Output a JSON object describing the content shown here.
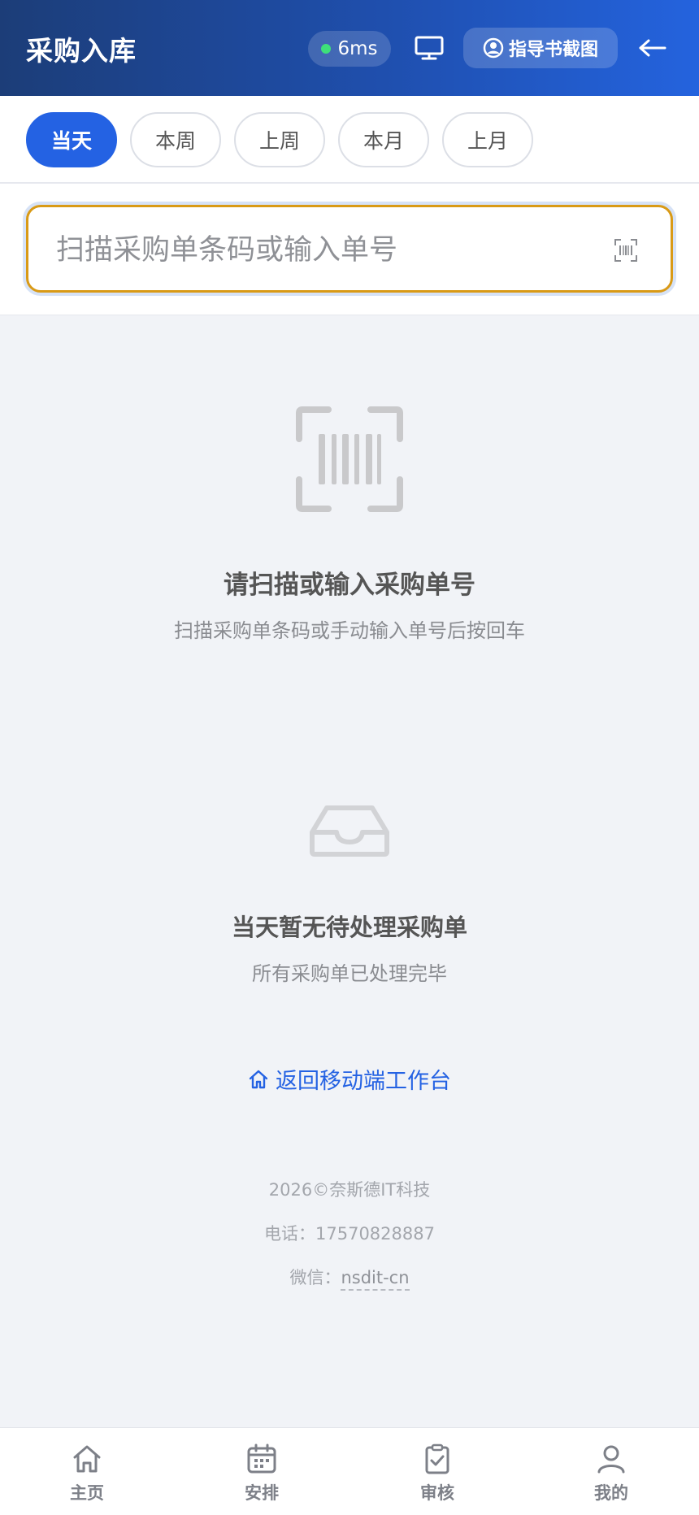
{
  "header": {
    "title": "采购入库",
    "latency": "6ms",
    "guide_label": "指导书截图"
  },
  "filters": [
    {
      "label": "当天",
      "active": true
    },
    {
      "label": "本周",
      "active": false
    },
    {
      "label": "上周",
      "active": false
    },
    {
      "label": "本月",
      "active": false
    },
    {
      "label": "上月",
      "active": false
    }
  ],
  "search": {
    "placeholder": "扫描采购单条码或输入单号",
    "value": ""
  },
  "scan_prompt": {
    "title": "请扫描或输入采购单号",
    "subtitle": "扫描采购单条码或手动输入单号后按回车"
  },
  "empty_state": {
    "title": "当天暂无待处理采购单",
    "subtitle": "所有采购单已处理完毕"
  },
  "return_link": "返回移动端工作台",
  "footer": {
    "copyright": "2026©奈斯德IT科技",
    "phone_label": "电话：",
    "phone": "17570828887",
    "wechat_label": "微信：",
    "wechat": "nsdit-cn"
  },
  "bottom_nav": [
    {
      "label": "主页",
      "icon": "home-icon"
    },
    {
      "label": "安排",
      "icon": "calendar-icon"
    },
    {
      "label": "审核",
      "icon": "clipboard-check-icon"
    },
    {
      "label": "我的",
      "icon": "user-icon"
    }
  ],
  "colors": {
    "accent": "#2462e3",
    "header_start": "#1c3d78",
    "header_end": "#2463de",
    "search_border": "#d99a16",
    "status_dot": "#3ee07a"
  }
}
